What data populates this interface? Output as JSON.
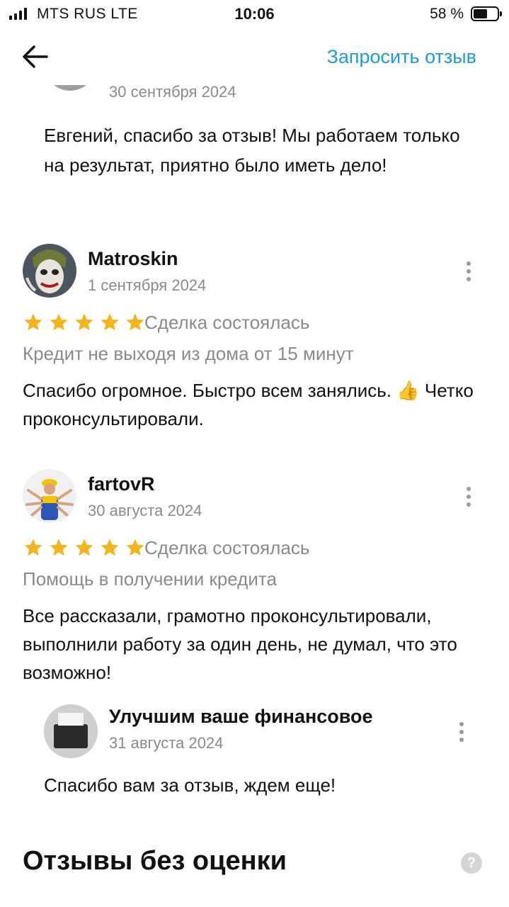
{
  "status_bar": {
    "carrier": "MTS RUS  LTE",
    "time": "10:06",
    "battery": "58 %"
  },
  "nav": {
    "back_icon": "arrow-left-icon",
    "request_review": "Запросить отзыв",
    "accent_color": "#1a9be0"
  },
  "prev_reply": {
    "date": "30 сентября 2024",
    "text": "Евгений, спасибо за отзыв! Мы работаем только на результат, приятно было иметь дело!"
  },
  "reviews": [
    {
      "author": "Matroskin",
      "date": "1 сентября 2024",
      "rating": 5,
      "deal_status": "Сделка состоялась",
      "service": "Кредит не выходя из дома от 15 минут",
      "text": "Спасибо огромное. Быстро всем занялись. 👍 Четко проконсультировали."
    },
    {
      "author": "fartovR",
      "date": "30 августа 2024",
      "rating": 5,
      "deal_status": "Сделка состоялась",
      "service": "Помощь в получении кредита",
      "text": "Все рассказали, грамотно проконсультировали, выполнили работу за один день, не думал, что это возможно!",
      "reply": {
        "author": "Улучшим ваше финансовое",
        "date": "31 августа 2024",
        "text": "Спасибо вам за отзыв, ждем еще!"
      }
    }
  ],
  "section": {
    "title": "Отзывы без оценки",
    "help_icon": "question-icon"
  },
  "colors": {
    "star": "#f6b41c",
    "muted_text": "#8a8a8a"
  }
}
